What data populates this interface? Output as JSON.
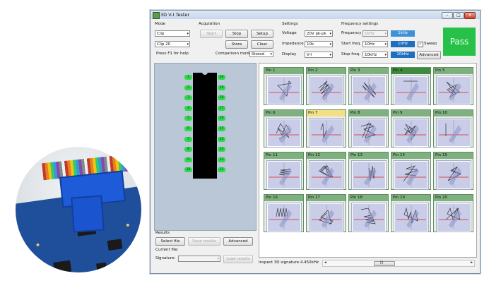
{
  "window": {
    "title": "3D V-I Tester",
    "minimize": "–",
    "maximize": "□",
    "close": "✕"
  },
  "mode": {
    "heading": "Mode",
    "select1": "Clip",
    "select2": "Clip 20",
    "hint": "Press F1 for help"
  },
  "acquisition": {
    "heading": "Acquisition",
    "start": "Start",
    "stop": "Stop",
    "setup": "Setup",
    "store": "Store",
    "clear": "Clear",
    "comparison_label": "Comparison mode",
    "comparison_value": "Stored"
  },
  "settings": {
    "heading": "Settings",
    "voltage_label": "Voltage",
    "voltage_value": "20V pk-pk",
    "impedance_label": "Impedance",
    "impedance_value": "10k",
    "display_label": "Display",
    "display_value": "V-I"
  },
  "frequency": {
    "heading": "Frequency settings",
    "freq_label": "Frequency",
    "freq_value": "1kHz",
    "freq_box": "1kHz",
    "start_label": "Start freq.",
    "start_value": "10Hz",
    "start_box": "10Hz",
    "stop_label": "Stop freq.",
    "stop_value": "10kHz",
    "stop_box": "10kHz",
    "sweep_label": "Sweep",
    "sweep_check": "✓",
    "advanced": "Advanced"
  },
  "status": {
    "pass": "Pass",
    "text": "Inspect 3D signature 4.450kHz",
    "scroll_left": "◂",
    "scroll_right": "▸",
    "grip": "|||"
  },
  "ic": {
    "left_pins": [
      "1",
      "2",
      "3",
      "4",
      "5",
      "6",
      "7",
      "8",
      "9",
      "10"
    ],
    "right_pins": [
      "20",
      "19",
      "18",
      "17",
      "16",
      "15",
      "14",
      "13",
      "12",
      "11"
    ]
  },
  "pins": [
    "Pin 1",
    "Pin 2",
    "Pin 3",
    "Pin 4",
    "Pin 5",
    "Pin 6",
    "Pin 7",
    "Pin 8",
    "Pin 9",
    "Pin 10",
    "Pin 11",
    "Pin 12",
    "Pin 13",
    "Pin 14",
    "Pin 15",
    "Pin 16",
    "Pin 17",
    "Pin 18",
    "Pin 19",
    "Pin 20"
  ],
  "results": {
    "heading": "Results",
    "select_file": "Select file",
    "save_results": "Save results",
    "advanced": "Advanced",
    "current_file_label": "Current file:",
    "signature_label": "Signature:",
    "load_results": "Load results"
  },
  "colors": {
    "pass": "#27c14a",
    "pin_active": "#2ed84a",
    "pin_highlight": "#f3df85",
    "accent": "#1d6fbf"
  }
}
